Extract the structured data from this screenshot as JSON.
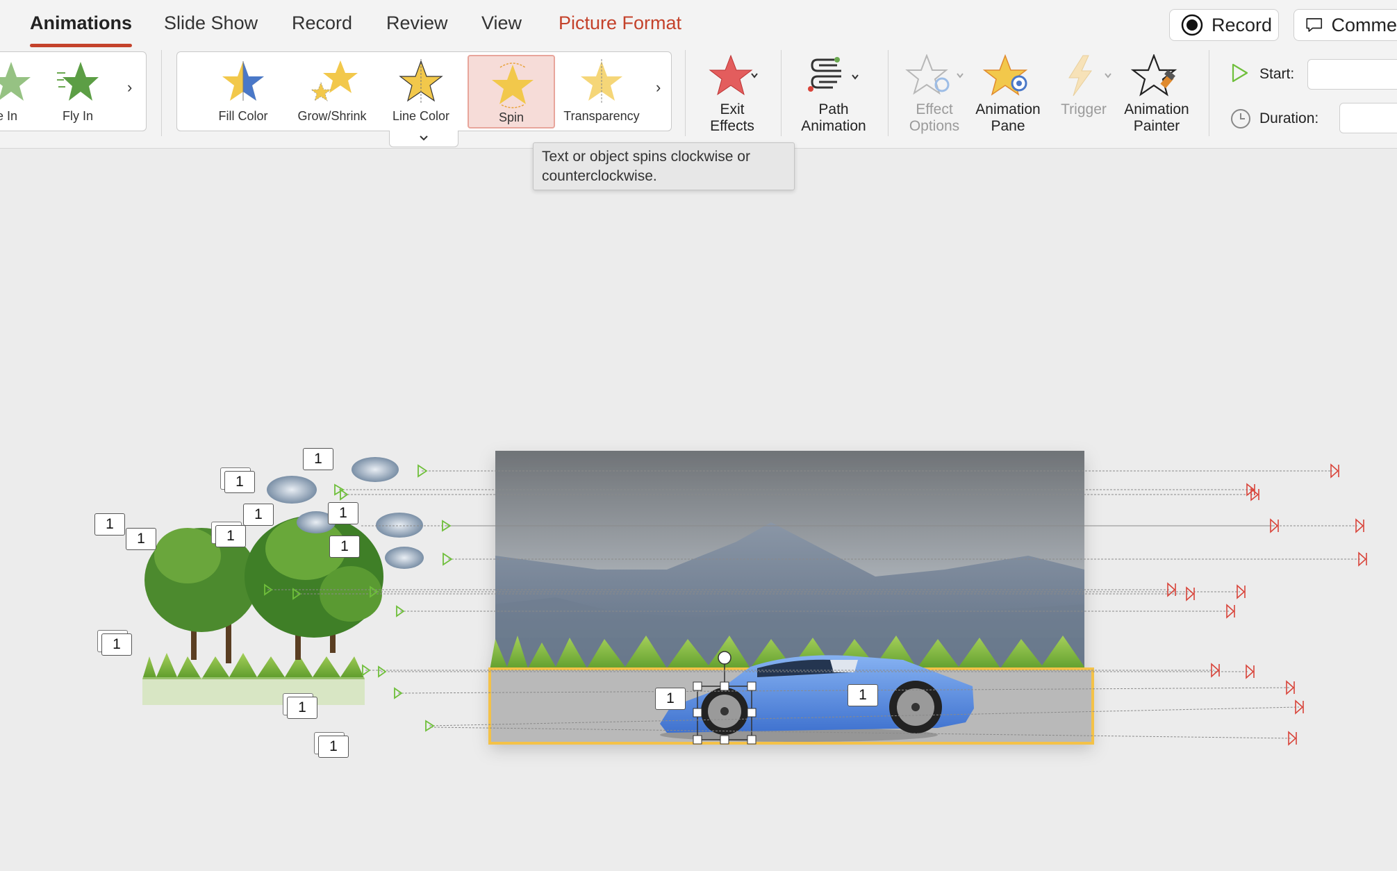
{
  "tabs": {
    "animations": "Animations",
    "slide_show": "Slide Show",
    "record": "Record",
    "review": "Review",
    "view": "View",
    "picture_format": "Picture Format"
  },
  "header_buttons": {
    "record": "Record",
    "comments": "Comme"
  },
  "entrance_gallery": {
    "items": [
      {
        "label": "e In"
      },
      {
        "label": "Fly In"
      }
    ]
  },
  "emphasis_gallery": {
    "items": [
      {
        "label": "Fill Color"
      },
      {
        "label": "Grow/Shrink"
      },
      {
        "label": "Line Color"
      },
      {
        "label": "Spin",
        "selected": true
      },
      {
        "label": "Transparency"
      }
    ]
  },
  "ribbon_buttons": {
    "exit_effects": [
      "Exit",
      "Effects"
    ],
    "path_animation": [
      "Path",
      "Animation"
    ],
    "effect_options": [
      "Effect",
      "Options"
    ],
    "animation_pane": [
      "Animation",
      "Pane"
    ],
    "trigger": "Trigger",
    "animation_painter": [
      "Animation",
      "Painter"
    ]
  },
  "timing": {
    "start_label": "Start:",
    "duration_label": "Duration:"
  },
  "tooltip": {
    "text": "Text or object spins clockwise or counterclockwise."
  },
  "animation_tags": {
    "value": "1"
  },
  "icons": {
    "record_icon": "record-dot-icon",
    "comment_icon": "speech-bubble-icon",
    "start_icon": "play-triangle-icon",
    "duration_icon": "clock-icon"
  },
  "colors": {
    "accent": "#c4422b",
    "selection_border": "#f4c248",
    "path_start": "#6fbf3b",
    "path_end": "#d9443a",
    "car_body": "#5b8fe6"
  }
}
